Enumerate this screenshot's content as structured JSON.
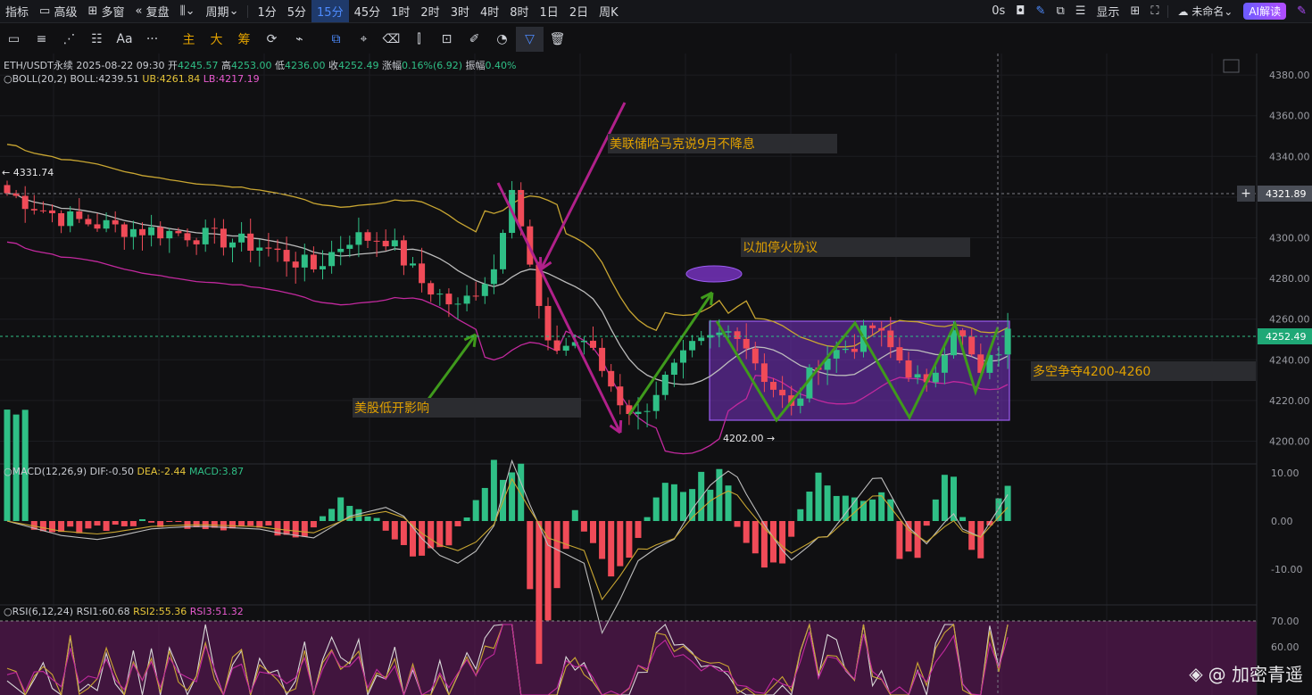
{
  "topbar": {
    "items": [
      "指标",
      "高级",
      "多窗",
      "复盘",
      "周期",
      "1分",
      "5分",
      "15分",
      "45分",
      "1时",
      "2时",
      "3时",
      "4时",
      "8时",
      "1日",
      "2日",
      "周K"
    ],
    "selected": "15分",
    "right": {
      "timer": "0s",
      "display": "显示",
      "unnamed": "未命名",
      "ai": "AI解读"
    }
  },
  "toolbar": {
    "labels": [
      "主",
      "大",
      "筹"
    ],
    "text_tool": "Aa",
    "more": "···"
  },
  "main_info": {
    "symbol": "ETH/USDT永续",
    "datetime": "2025-08-22 09:30",
    "open_label": "开",
    "open": "4245.57",
    "high_label": "高",
    "high": "4253.00",
    "low_label": "低",
    "low": "4236.00",
    "close_label": "收",
    "close": "4252.49",
    "change_label": "涨幅",
    "change": "0.16%(6.92)",
    "amp_label": "振幅",
    "amp": "0.40%"
  },
  "boll_info": {
    "name": "BOLL(20,2)",
    "boll": "BOLL:4239.51",
    "ub": "UB:4261.84",
    "lb": "LB:4217.19"
  },
  "macd_info": {
    "name": "MACD(12,26,9)",
    "dif": "DIF:-0.50",
    "dea": "DEA:-2.44",
    "macd": "MACD:3.87"
  },
  "rsi_info": {
    "name": "RSI(6,12,24)",
    "rsi1": "RSI1:60.68",
    "rsi2": "RSI2:55.36",
    "rsi3": "RSI3:51.32"
  },
  "axis": {
    "price_ticks": [
      "4380.00",
      "4360.00",
      "4340.00",
      "4320.00",
      "4300.00",
      "4280.00",
      "4260.00",
      "4240.00",
      "4220.00",
      "4200.00"
    ],
    "macd_ticks": [
      "10.00",
      "0.00",
      "-10.00"
    ],
    "rsi_ticks": [
      "70.00",
      "60.00"
    ]
  },
  "markers": {
    "high": "4331.74",
    "low": "4202.00",
    "crosshair": "4321.89",
    "last": "4252.49"
  },
  "annotations": {
    "fed": "美联储哈马克说9月不降息",
    "ceasefire": "以加停火协议",
    "stocks": "美股低开影响",
    "range": "多空争夺4200-4260"
  },
  "watermark": "@ 加密青遥",
  "colors": {
    "up": "#2fbf86",
    "down": "#f04b58",
    "boll_mid": "#bcbcbc",
    "boll_ub": "#c9a632",
    "boll_lb": "#c2299e",
    "accent": "#4e8cff",
    "annotation_text": "#e0a000",
    "arrow_green": "#3f9a1c",
    "arrow_magenta": "#b0208a",
    "zone": "#7a33c7"
  }
}
